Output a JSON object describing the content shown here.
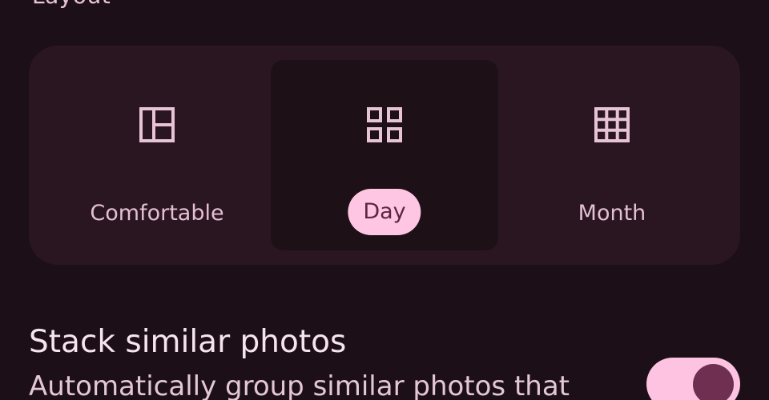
{
  "layout_section": {
    "title": "Layout",
    "options": [
      {
        "label": "Comfortable",
        "icon": "view-comfortable-icon",
        "selected": false
      },
      {
        "label": "Day",
        "icon": "grid-2x2-icon",
        "selected": true
      },
      {
        "label": "Month",
        "icon": "grid-3x3-icon",
        "selected": false
      }
    ]
  },
  "stack_similar": {
    "title": "Stack similar photos",
    "description": "Automatically group similar photos that",
    "enabled": true
  },
  "colors": {
    "background": "#1c0f18",
    "card": "#2a1620",
    "selected_option": "#1e1017",
    "accent": "#ffc6e4",
    "toggle_knob": "#6e2f50"
  }
}
